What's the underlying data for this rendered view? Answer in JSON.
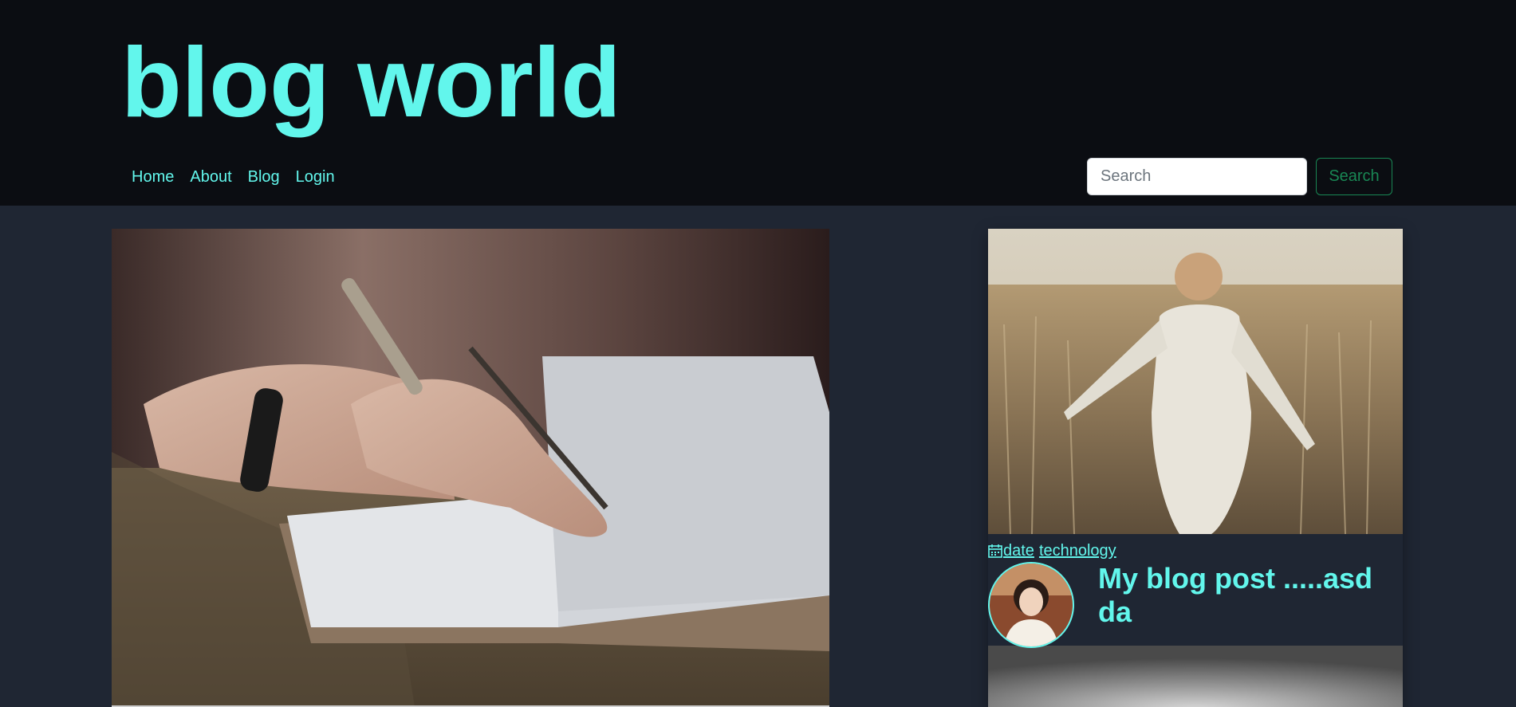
{
  "site": {
    "title": "blog world"
  },
  "nav": [
    {
      "label": "Home"
    },
    {
      "label": "About"
    },
    {
      "label": "Blog"
    },
    {
      "label": "Login"
    }
  ],
  "search": {
    "placeholder": "Search",
    "value": "",
    "button_label": "Search"
  },
  "colors": {
    "accent": "#62f6ec",
    "header_bg": "#0b0d12",
    "body_bg": "#1f2633",
    "search_button": "#198754"
  },
  "post": {
    "date_label": "date",
    "category": "technology",
    "title": "My blog post .....asd da",
    "icons": {
      "date": "calendar-icon"
    }
  }
}
